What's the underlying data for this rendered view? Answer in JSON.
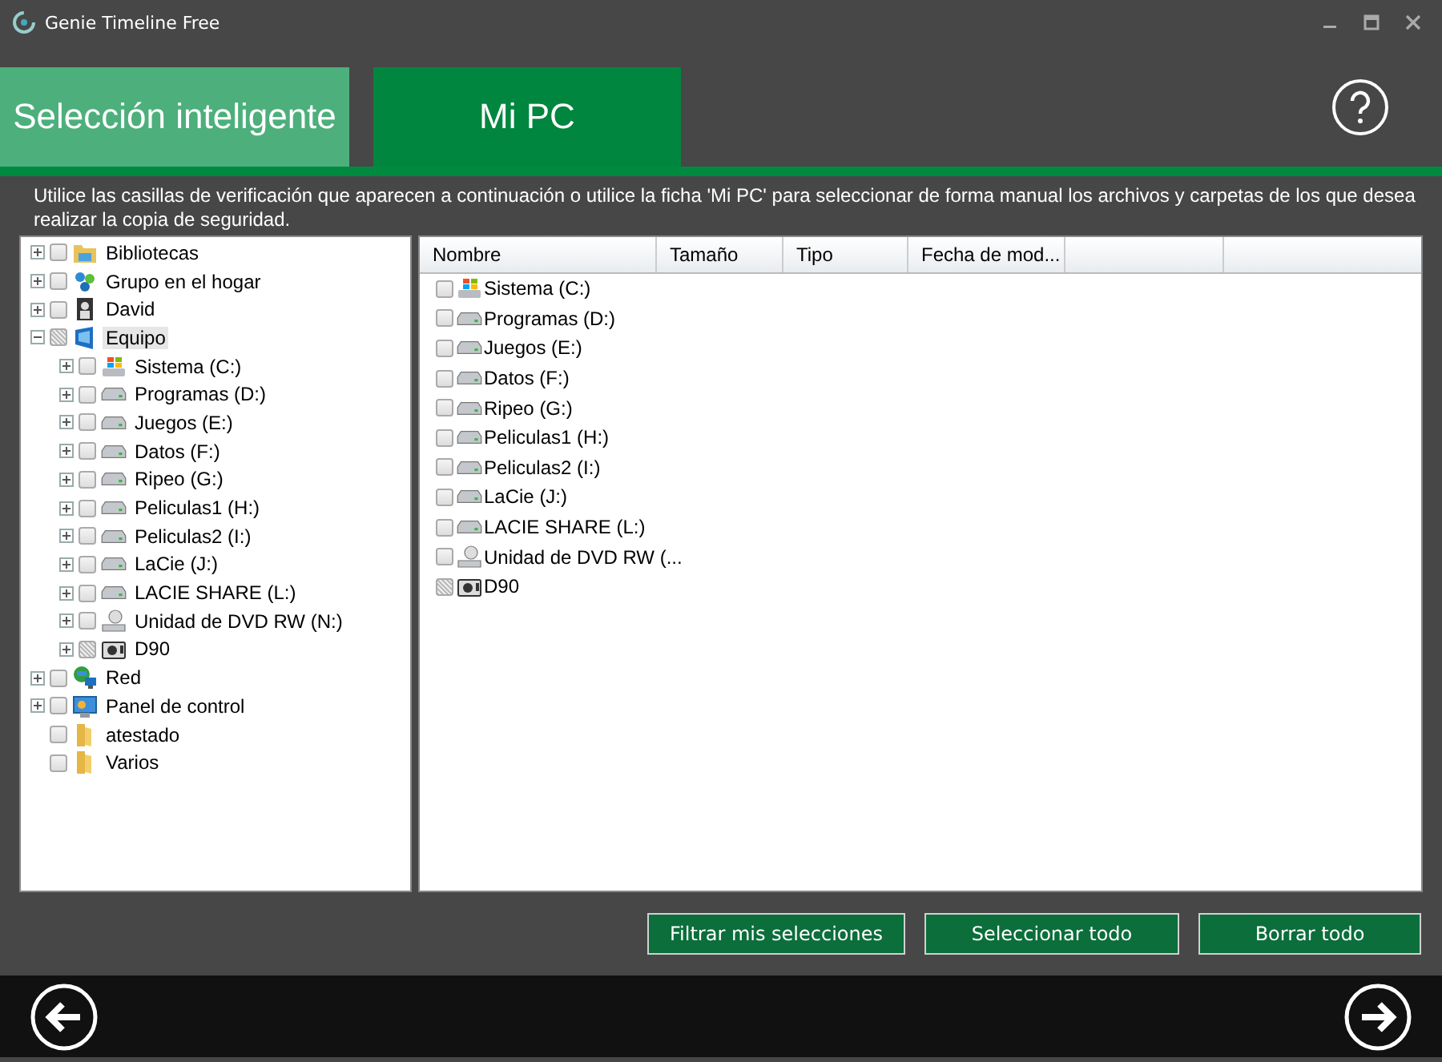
{
  "window": {
    "title": "Genie Timeline Free"
  },
  "tabs": [
    {
      "label": "Selección inteligente",
      "selected": false
    },
    {
      "label": "Mi PC",
      "selected": true
    }
  ],
  "description": "Utilice las casillas de verificación que aparecen a continuación o utilice la ficha 'Mi PC' para seleccionar de forma manual los archivos y carpetas de los que desea realizar la copia de seguridad.",
  "tree": [
    {
      "label": "Bibliotecas",
      "kind": "library",
      "expandable": true,
      "expanded": false,
      "checked": false,
      "partial": false,
      "selected": false
    },
    {
      "label": "Grupo en el hogar",
      "kind": "homegroup",
      "expandable": true,
      "expanded": false,
      "checked": false,
      "partial": false,
      "selected": false
    },
    {
      "label": "David",
      "kind": "user",
      "expandable": true,
      "expanded": false,
      "checked": false,
      "partial": false,
      "selected": false
    },
    {
      "label": "Equipo",
      "kind": "computer",
      "expandable": true,
      "expanded": true,
      "checked": false,
      "partial": true,
      "selected": true,
      "children": [
        {
          "label": "Sistema (C:)",
          "kind": "system-drive",
          "expandable": true,
          "expanded": false,
          "checked": false,
          "partial": false,
          "selected": false
        },
        {
          "label": "Programas (D:)",
          "kind": "drive",
          "expandable": true,
          "expanded": false,
          "checked": false,
          "partial": false,
          "selected": false
        },
        {
          "label": "Juegos (E:)",
          "kind": "drive",
          "expandable": true,
          "expanded": false,
          "checked": false,
          "partial": false,
          "selected": false
        },
        {
          "label": "Datos (F:)",
          "kind": "drive",
          "expandable": true,
          "expanded": false,
          "checked": false,
          "partial": false,
          "selected": false
        },
        {
          "label": "Ripeo (G:)",
          "kind": "drive",
          "expandable": true,
          "expanded": false,
          "checked": false,
          "partial": false,
          "selected": false
        },
        {
          "label": "Peliculas1 (H:)",
          "kind": "drive",
          "expandable": true,
          "expanded": false,
          "checked": false,
          "partial": false,
          "selected": false
        },
        {
          "label": "Peliculas2 (I:)",
          "kind": "drive",
          "expandable": true,
          "expanded": false,
          "checked": false,
          "partial": false,
          "selected": false
        },
        {
          "label": "LaCie (J:)",
          "kind": "drive",
          "expandable": true,
          "expanded": false,
          "checked": false,
          "partial": false,
          "selected": false
        },
        {
          "label": "LACIE SHARE (L:)",
          "kind": "drive",
          "expandable": true,
          "expanded": false,
          "checked": false,
          "partial": false,
          "selected": false
        },
        {
          "label": "Unidad de DVD RW (N:)",
          "kind": "dvd-drive",
          "expandable": true,
          "expanded": false,
          "checked": false,
          "partial": false,
          "selected": false
        },
        {
          "label": "D90",
          "kind": "camera",
          "expandable": true,
          "expanded": false,
          "checked": false,
          "partial": true,
          "selected": false
        }
      ]
    },
    {
      "label": "Red",
      "kind": "network",
      "expandable": true,
      "expanded": false,
      "checked": false,
      "partial": false,
      "selected": false
    },
    {
      "label": "Panel de control",
      "kind": "control-panel",
      "expandable": true,
      "expanded": false,
      "checked": false,
      "partial": false,
      "selected": false
    },
    {
      "label": "atestado",
      "kind": "folder",
      "expandable": false,
      "checked": false,
      "partial": false,
      "selected": false
    },
    {
      "label": "Varios",
      "kind": "folder",
      "expandable": false,
      "checked": false,
      "partial": false,
      "selected": false
    }
  ],
  "list": {
    "columns": [
      "Nombre",
      "Tamaño",
      "Tipo",
      "Fecha de mod..."
    ],
    "rows": [
      {
        "name": "Sistema (C:)",
        "kind": "system-drive",
        "checked": false,
        "partial": false
      },
      {
        "name": "Programas (D:)",
        "kind": "drive",
        "checked": false,
        "partial": false
      },
      {
        "name": "Juegos (E:)",
        "kind": "drive",
        "checked": false,
        "partial": false
      },
      {
        "name": "Datos (F:)",
        "kind": "drive",
        "checked": false,
        "partial": false
      },
      {
        "name": "Ripeo (G:)",
        "kind": "drive",
        "checked": false,
        "partial": false
      },
      {
        "name": "Peliculas1 (H:)",
        "kind": "drive",
        "checked": false,
        "partial": false
      },
      {
        "name": "Peliculas2 (I:)",
        "kind": "drive",
        "checked": false,
        "partial": false
      },
      {
        "name": "LaCie (J:)",
        "kind": "drive",
        "checked": false,
        "partial": false
      },
      {
        "name": "LACIE SHARE (L:)",
        "kind": "drive",
        "checked": false,
        "partial": false
      },
      {
        "name": "Unidad de DVD RW (...",
        "kind": "dvd-drive",
        "checked": false,
        "partial": false
      },
      {
        "name": "D90",
        "kind": "camera",
        "checked": false,
        "partial": true
      }
    ]
  },
  "buttons": [
    "Filtrar mis selecciones",
    "Seleccionar todo",
    "Borrar todo"
  ]
}
